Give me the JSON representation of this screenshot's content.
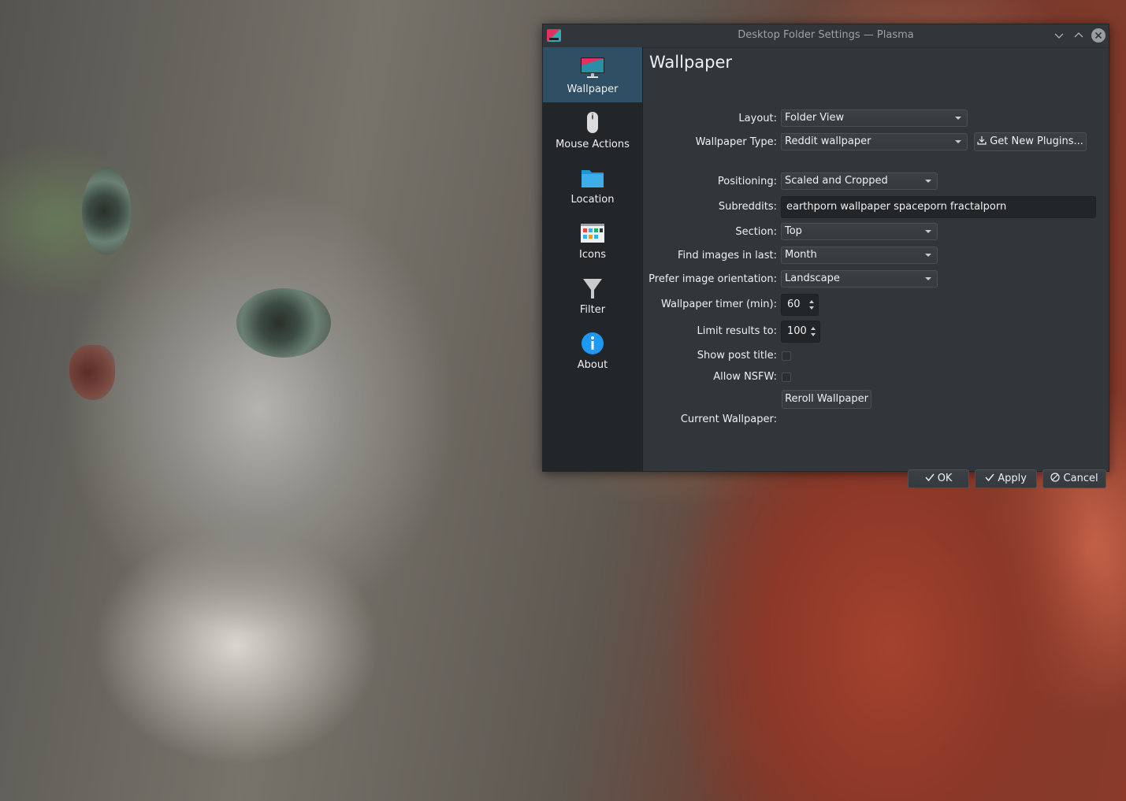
{
  "window": {
    "title": "Desktop Folder Settings — Plasma"
  },
  "sidebar": {
    "items": [
      {
        "label": "Wallpaper",
        "icon": "monitor-icon",
        "selected": true
      },
      {
        "label": "Mouse Actions",
        "icon": "mouse-icon",
        "selected": false
      },
      {
        "label": "Location",
        "icon": "folder-icon",
        "selected": false
      },
      {
        "label": "Icons",
        "icon": "icons-view-icon",
        "selected": false
      },
      {
        "label": "Filter",
        "icon": "filter-icon",
        "selected": false
      },
      {
        "label": "About",
        "icon": "info-icon",
        "selected": false
      }
    ]
  },
  "page": {
    "title": "Wallpaper",
    "layout": {
      "label": "Layout:",
      "value": "Folder View"
    },
    "wallpaper_type": {
      "label": "Wallpaper Type:",
      "value": "Reddit wallpaper"
    },
    "get_new_plugins": {
      "label": "Get New Plugins...",
      "icon": "download-icon"
    },
    "positioning": {
      "label": "Positioning:",
      "value": "Scaled and Cropped"
    },
    "subreddits": {
      "label": "Subreddits:",
      "value": "earthporn wallpaper spaceporn fractalporn"
    },
    "section": {
      "label": "Section:",
      "value": "Top"
    },
    "find_images": {
      "label": "Find images in last:",
      "value": "Month"
    },
    "orientation": {
      "label": "Prefer image orientation:",
      "value": "Landscape"
    },
    "timer": {
      "label": "Wallpaper timer (min):",
      "value": "60"
    },
    "limit": {
      "label": "Limit results to:",
      "value": "100"
    },
    "show_post_title": {
      "label": "Show post title:",
      "checked": false
    },
    "allow_nsfw": {
      "label": "Allow NSFW:",
      "checked": false
    },
    "reroll": {
      "label": "Reroll Wallpaper"
    },
    "current_wallpaper": {
      "label": "Current Wallpaper:",
      "value": ""
    }
  },
  "footer": {
    "ok": "OK",
    "apply": "Apply",
    "cancel": "Cancel"
  },
  "colors": {
    "window_bg": "#31363b",
    "sidebar_bg": "#232629",
    "selection": "#2f5064",
    "text": "#eff0f1"
  }
}
